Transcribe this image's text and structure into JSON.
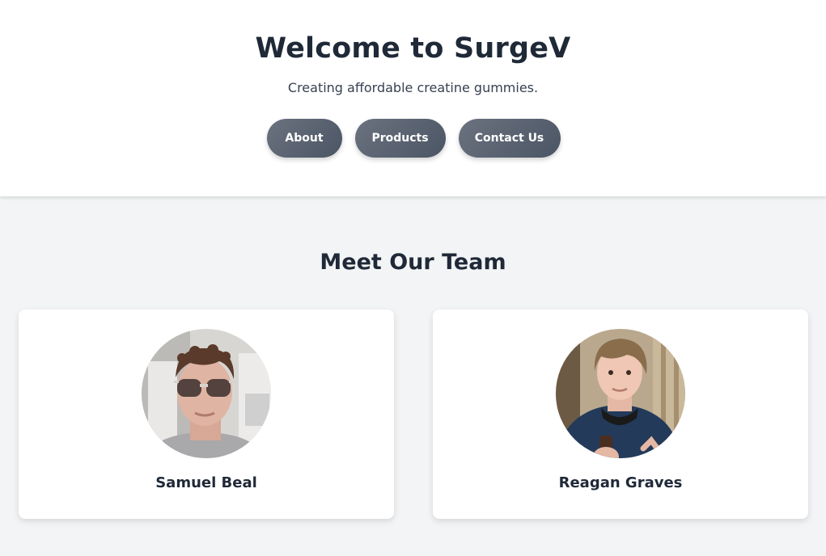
{
  "hero": {
    "title": "Welcome to SurgeV",
    "subtitle": "Creating affordable creatine gummies.",
    "nav": {
      "about_label": "About",
      "products_label": "Products",
      "contact_label": "Contact Us"
    }
  },
  "team": {
    "heading": "Meet Our Team",
    "members": [
      {
        "name": "Samuel Beal",
        "photo_icon": "portrait-photo"
      },
      {
        "name": "Reagan Graves",
        "photo_icon": "portrait-photo"
      }
    ]
  },
  "colors": {
    "button_gradient_start": "#6b7280",
    "button_gradient_end": "#4b5563",
    "text_dark": "#1f2937",
    "page_background": "#f3f4f6",
    "card_background": "#ffffff"
  }
}
